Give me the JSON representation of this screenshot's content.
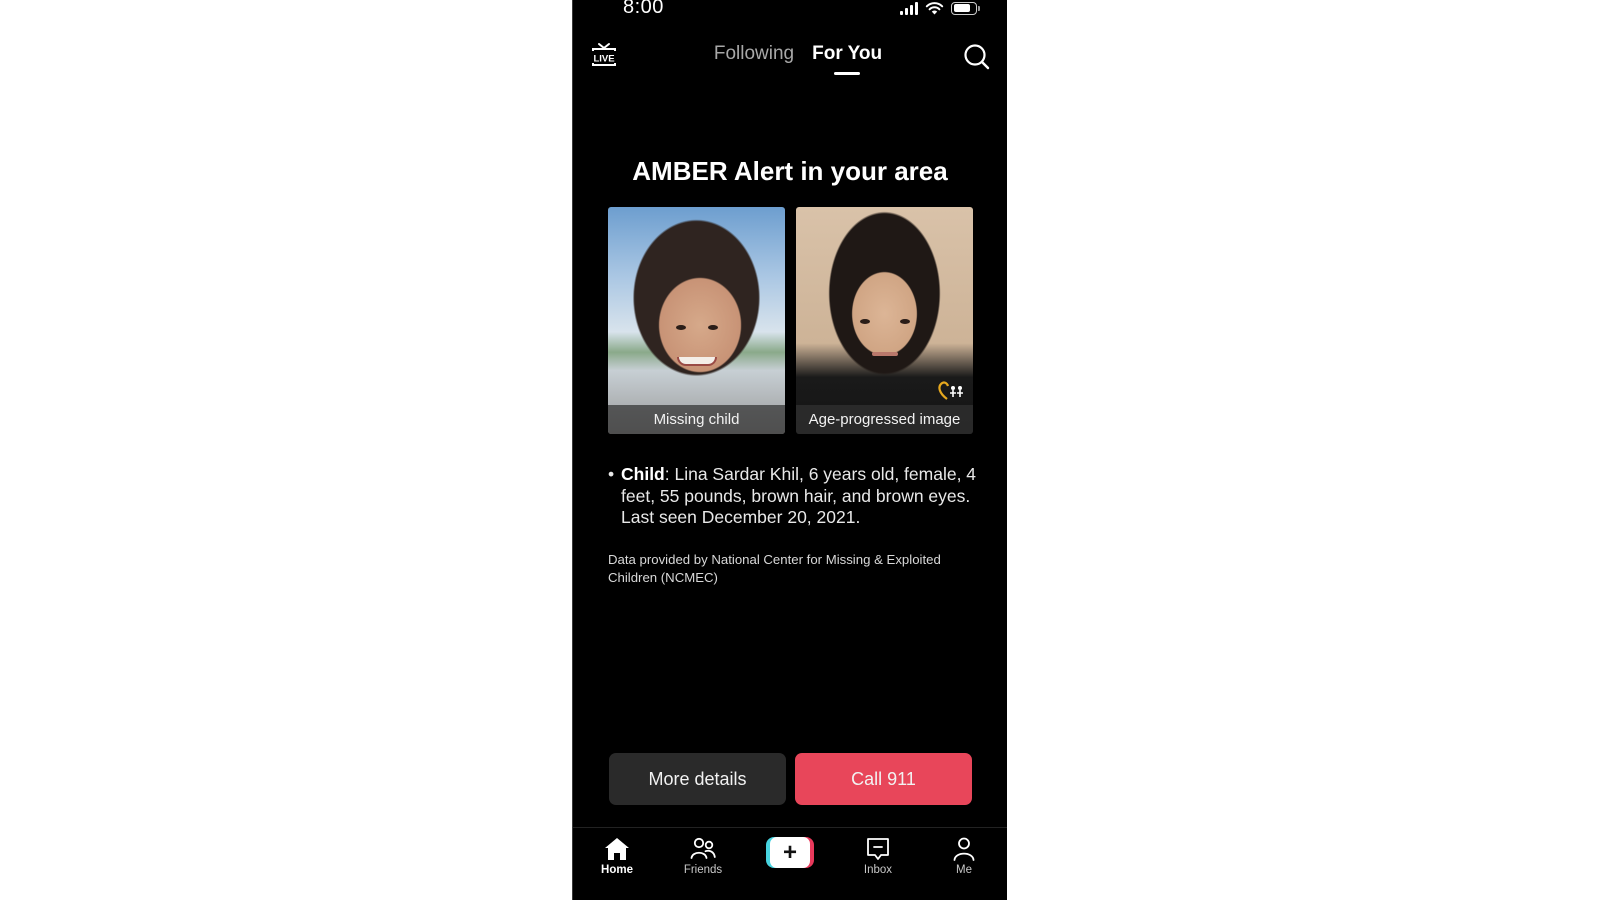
{
  "status_bar": {
    "time": "8:00",
    "icons": [
      "cellular-signal-icon",
      "wifi-icon",
      "battery-icon"
    ]
  },
  "top_nav": {
    "live_icon": "live-tv-icon",
    "live_label": "LIVE",
    "tabs": [
      {
        "label": "Following",
        "active": false
      },
      {
        "label": "For You",
        "active": true
      }
    ],
    "search_icon": "search-icon"
  },
  "alert": {
    "title": "AMBER Alert in your area",
    "photos": [
      {
        "caption": "Missing child"
      },
      {
        "caption": "Age-progressed image"
      }
    ],
    "details": {
      "label": "Child",
      "text": ": Lina Sardar Khil, 6 years old, female, 4 feet, 55 pounds, brown hair, and brown eyes. Last seen December 20, 2021."
    },
    "credit": "Data provided by National Center for Missing & Exploited Children (NCMEC)"
  },
  "actions": {
    "more_details": "More details",
    "call": "Call 911"
  },
  "colors": {
    "call_button": "#E8465A",
    "more_button": "#2A2A2A",
    "background": "#000000",
    "plus_cyan": "#47D4E0",
    "plus_red": "#E8395B"
  },
  "bottom_nav": {
    "items": [
      {
        "label": "Home",
        "icon": "home-icon",
        "active": true
      },
      {
        "label": "Friends",
        "icon": "friends-icon",
        "active": false
      },
      {
        "label": "",
        "icon": "create-plus-icon",
        "active": false
      },
      {
        "label": "Inbox",
        "icon": "inbox-icon",
        "active": false
      },
      {
        "label": "Me",
        "icon": "profile-icon",
        "active": false
      }
    ],
    "plus_symbol": "+"
  }
}
